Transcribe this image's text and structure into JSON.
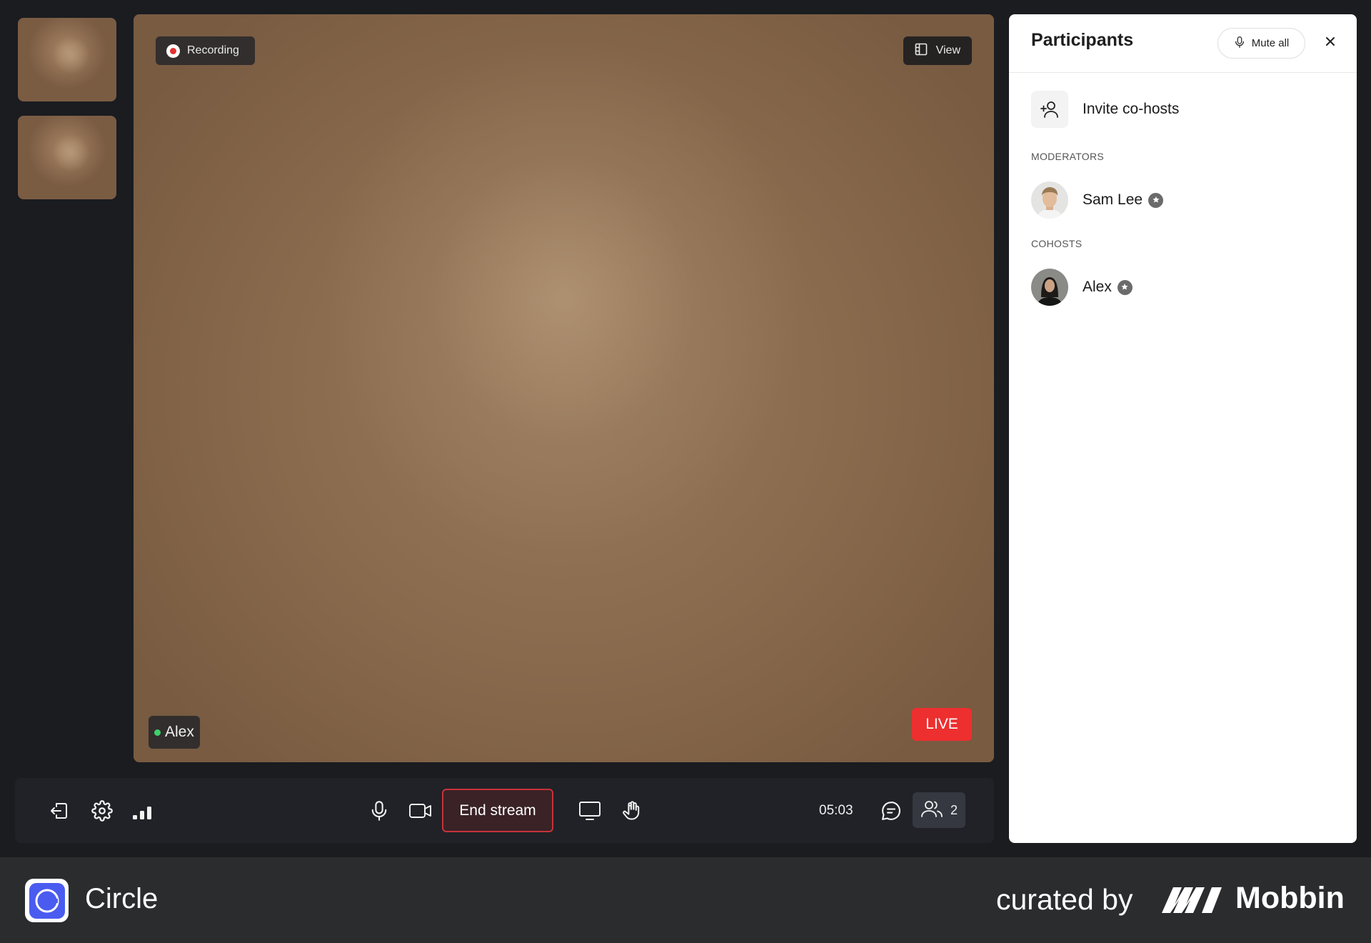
{
  "video": {
    "recording_label": "Recording",
    "view_label": "View",
    "speaker_name": "Alex",
    "live_label": "LIVE"
  },
  "controls": {
    "end_stream_label": "End stream",
    "timer": "05:03",
    "participant_count": "2"
  },
  "panel": {
    "title": "Participants",
    "mute_all_label": "Mute all",
    "invite_label": "Invite co-hosts",
    "moderators_label": "MODERATORS",
    "cohosts_label": "COHOSTS",
    "moderators": [
      {
        "name": "Sam Lee"
      }
    ],
    "cohosts": [
      {
        "name": "Alex"
      }
    ]
  },
  "footer": {
    "brand": "Circle",
    "curated_by": "curated by",
    "curator": "Mobbin"
  },
  "colors": {
    "live": "#ee2f2f",
    "end_stream_border": "#c7323a",
    "online_dot": "#3dd16a",
    "brand_accent": "#4a5cf0"
  }
}
